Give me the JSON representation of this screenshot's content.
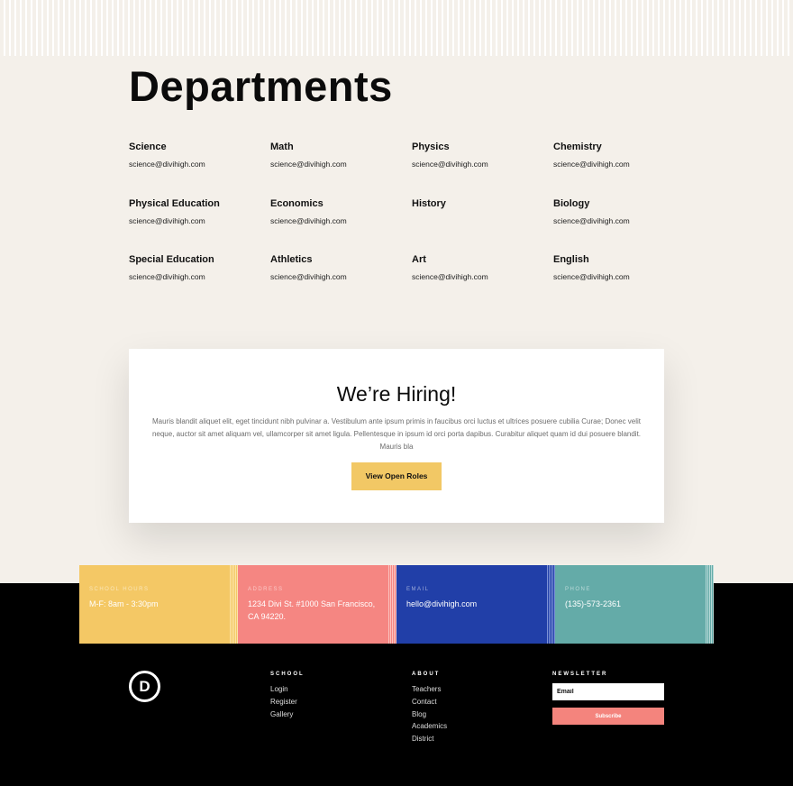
{
  "page": {
    "title": "Departments"
  },
  "departments": [
    {
      "name": "Science",
      "email": "science@divihigh.com"
    },
    {
      "name": "Math",
      "email": "science@divihigh.com"
    },
    {
      "name": "Physics",
      "email": "science@divihigh.com"
    },
    {
      "name": "Chemistry",
      "email": "science@divihigh.com"
    },
    {
      "name": "Physical Education",
      "email": "science@divihigh.com"
    },
    {
      "name": "Economics",
      "email": "science@divihigh.com"
    },
    {
      "name": "History",
      "email": ""
    },
    {
      "name": "Biology",
      "email": "science@divihigh.com"
    },
    {
      "name": "Special Education",
      "email": "science@divihigh.com"
    },
    {
      "name": "Athletics",
      "email": "science@divihigh.com"
    },
    {
      "name": "Art",
      "email": "science@divihigh.com"
    },
    {
      "name": "English",
      "email": "science@divihigh.com"
    }
  ],
  "hiring": {
    "title": "We’re Hiring!",
    "text": "Mauris blandit aliquet elit, eget tincidunt nibh pulvinar a. Vestibulum ante ipsum primis in faucibus orci luctus et ultrices posuere cubilia Curae; Donec velit neque, auctor sit amet aliquam vel, ullamcorper sit amet ligula. Pellentesque in ipsum id orci porta dapibus. Curabitur aliquet quam id dui posuere blandit. Mauris bla",
    "button_label": "View Open Roles"
  },
  "info": {
    "hours": {
      "label": "SCHOOL HOURS",
      "value": "M-F: 8am - 3:30pm"
    },
    "address": {
      "label": "ADDRESS",
      "value": "1234 Divi St. #1000 San Francisco, CA 94220."
    },
    "email": {
      "label": "EMAIL",
      "value": "hello@divihigh.com"
    },
    "phone": {
      "label": "PHONE",
      "value": "(135)-573-2361"
    }
  },
  "colors": {
    "yellow": "#f4c865",
    "coral": "#f58682",
    "blue": "#213fa8",
    "teal": "#64aba8",
    "background": "#f4f0ea"
  },
  "footer": {
    "logo_letter": "D",
    "school": {
      "heading": "SCHOOL",
      "links": [
        "Login",
        "Register",
        "Gallery"
      ]
    },
    "about": {
      "heading": "ABOUT",
      "links": [
        "Teachers",
        "Contact",
        "Blog",
        "Academics",
        "District"
      ]
    },
    "newsletter": {
      "heading": "NEWSLETTER",
      "email_placeholder": "Email",
      "button_label": "Subscribe"
    }
  }
}
